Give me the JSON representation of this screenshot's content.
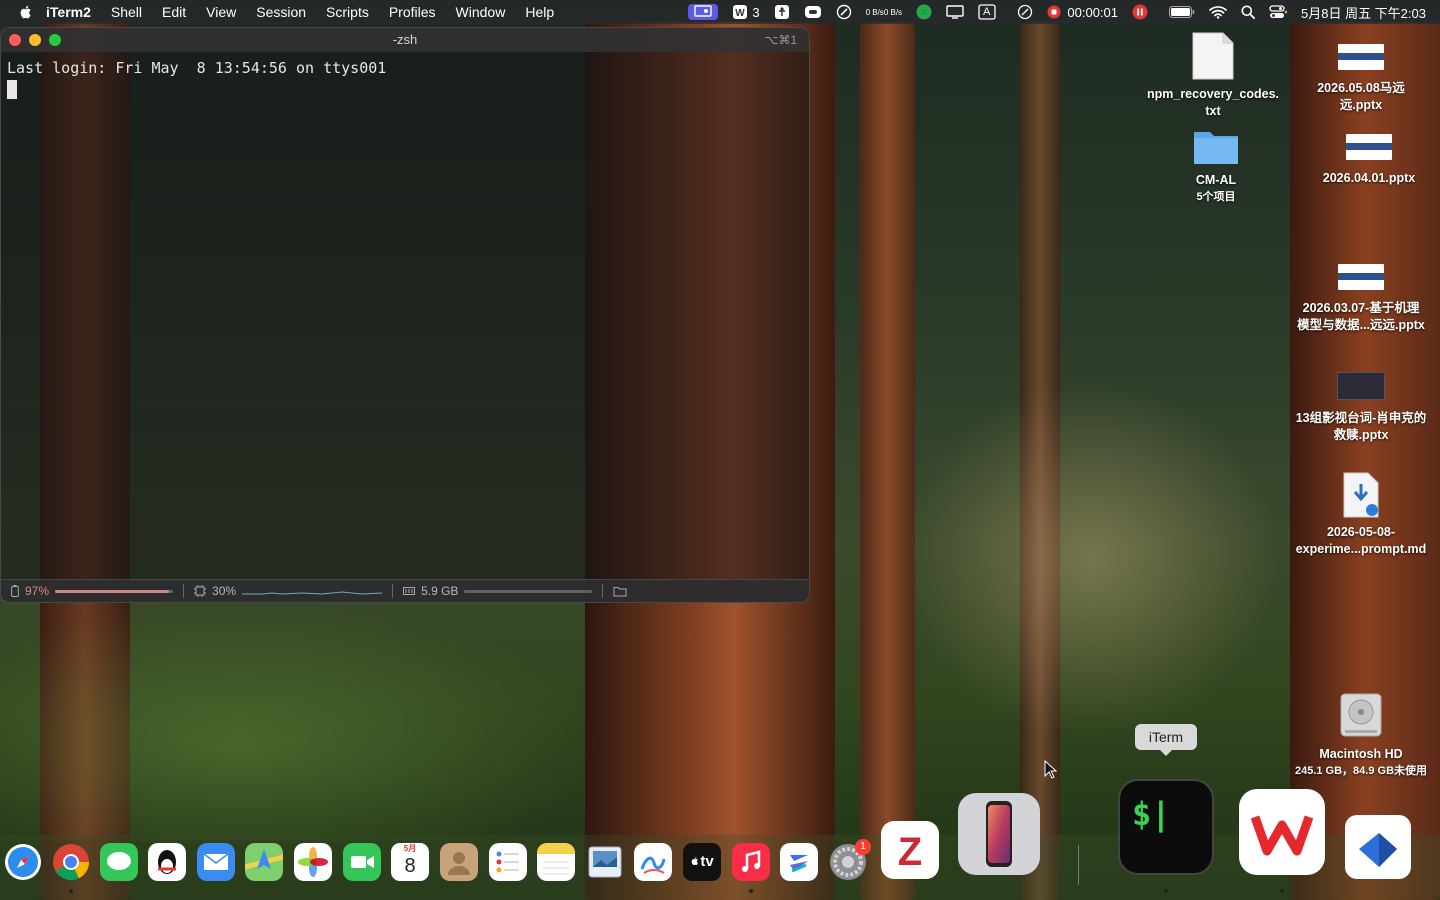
{
  "menubar": {
    "app": "iTerm2",
    "items": [
      "Shell",
      "Edit",
      "View",
      "Session",
      "Scripts",
      "Profiles",
      "Window",
      "Help"
    ],
    "status": {
      "wps_count": "3",
      "net_up": "0 B/s",
      "net_down": "0 B/s",
      "input_label": "A",
      "record_time": "00:00:01",
      "datetime": "5月8日 周五 下午2:03"
    }
  },
  "terminal": {
    "title": "-zsh",
    "shortcut": "⌥⌘1",
    "login_line": "Last login: Fri May  8 13:54:56 on ttys001",
    "statusbar": {
      "battery": "97%",
      "battery_fill": 0.97,
      "cpu": "30%",
      "memory": "5.9 GB"
    }
  },
  "desktop": {
    "icons": [
      {
        "name": "npm_recovery_codes.txt",
        "line1": "npm_recovery_codes.",
        "line2": "txt"
      },
      {
        "name": "2026.05.08马远远.pptx",
        "line1": "2026.05.08马远",
        "line2": "远.pptx"
      },
      {
        "name": "CM-AL",
        "line1": "CM-AL",
        "line2": "5个项目"
      },
      {
        "name": "2026.04.01.pptx",
        "line1": "2026.04.01.pptx",
        "line2": ""
      },
      {
        "name": "2026.03.07",
        "line1": "2026.03.07-基于机理",
        "line2": "模型与数据...远远.pptx"
      },
      {
        "name": "13组影视台词",
        "line1": "13组影视台词-肖申克的",
        "line2": "救赎.pptx"
      },
      {
        "name": "2026-05-08-experiment",
        "line1": "2026-05-08-",
        "line2": "experime...prompt.md"
      },
      {
        "name": "Macintosh HD",
        "line1": "Macintosh HD",
        "line2": "245.1 GB，84.9 GB未使用"
      }
    ]
  },
  "dock": {
    "tooltip": "iTerm",
    "calendar_month": "5月",
    "calendar_day": "8",
    "settings_badge": "1",
    "tv_label": "tv"
  },
  "colors": {
    "menubar_highlight": "#5b5ce6",
    "record_red": "#e53935",
    "terminal_green": "#39d353"
  }
}
